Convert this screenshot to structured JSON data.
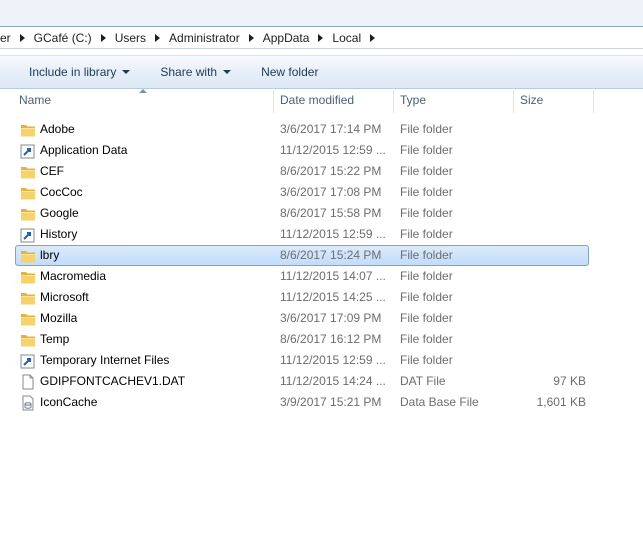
{
  "breadcrumb": {
    "segments": [
      "er",
      "GCafé (C:)",
      "Users",
      "Administrator",
      "AppData",
      "Local"
    ]
  },
  "toolbar": {
    "include_label": "Include in library",
    "share_label": "Share with",
    "newfolder_label": "New folder"
  },
  "columns": {
    "name": "Name",
    "date": "Date modified",
    "type": "Type",
    "size": "Size"
  },
  "files": [
    {
      "name": "Adobe",
      "date": "3/6/2017 17:14 PM",
      "type": "File folder",
      "size": "",
      "icon": "folder-icon"
    },
    {
      "name": "Application Data",
      "date": "11/12/2015 12:59 ...",
      "type": "File folder",
      "size": "",
      "icon": "shortcut-icon"
    },
    {
      "name": "CEF",
      "date": "8/6/2017 15:22 PM",
      "type": "File folder",
      "size": "",
      "icon": "folder-icon"
    },
    {
      "name": "CocCoc",
      "date": "3/6/2017 17:08 PM",
      "type": "File folder",
      "size": "",
      "icon": "folder-icon"
    },
    {
      "name": "Google",
      "date": "8/6/2017 15:58 PM",
      "type": "File folder",
      "size": "",
      "icon": "folder-icon"
    },
    {
      "name": "History",
      "date": "11/12/2015 12:59 ...",
      "type": "File folder",
      "size": "",
      "icon": "shortcut-icon"
    },
    {
      "name": "lbry",
      "date": "8/6/2017 15:24 PM",
      "type": "File folder",
      "size": "",
      "icon": "folder-icon",
      "selected": true
    },
    {
      "name": "Macromedia",
      "date": "11/12/2015 14:07 ...",
      "type": "File folder",
      "size": "",
      "icon": "folder-icon"
    },
    {
      "name": "Microsoft",
      "date": "11/12/2015 14:25 ...",
      "type": "File folder",
      "size": "",
      "icon": "folder-icon"
    },
    {
      "name": "Mozilla",
      "date": "3/6/2017 17:09 PM",
      "type": "File folder",
      "size": "",
      "icon": "folder-icon"
    },
    {
      "name": "Temp",
      "date": "8/6/2017 16:12 PM",
      "type": "File folder",
      "size": "",
      "icon": "folder-icon"
    },
    {
      "name": "Temporary Internet Files",
      "date": "11/12/2015 12:59 ...",
      "type": "File folder",
      "size": "",
      "icon": "shortcut-icon"
    },
    {
      "name": "GDIPFONTCACHEV1.DAT",
      "date": "11/12/2015 14:24 ...",
      "type": "DAT File",
      "size": "97 KB",
      "icon": "file-icon"
    },
    {
      "name": "IconCache",
      "date": "3/9/2017 15:21 PM",
      "type": "Data Base File",
      "size": "1,601 KB",
      "icon": "database-file-icon"
    }
  ]
}
